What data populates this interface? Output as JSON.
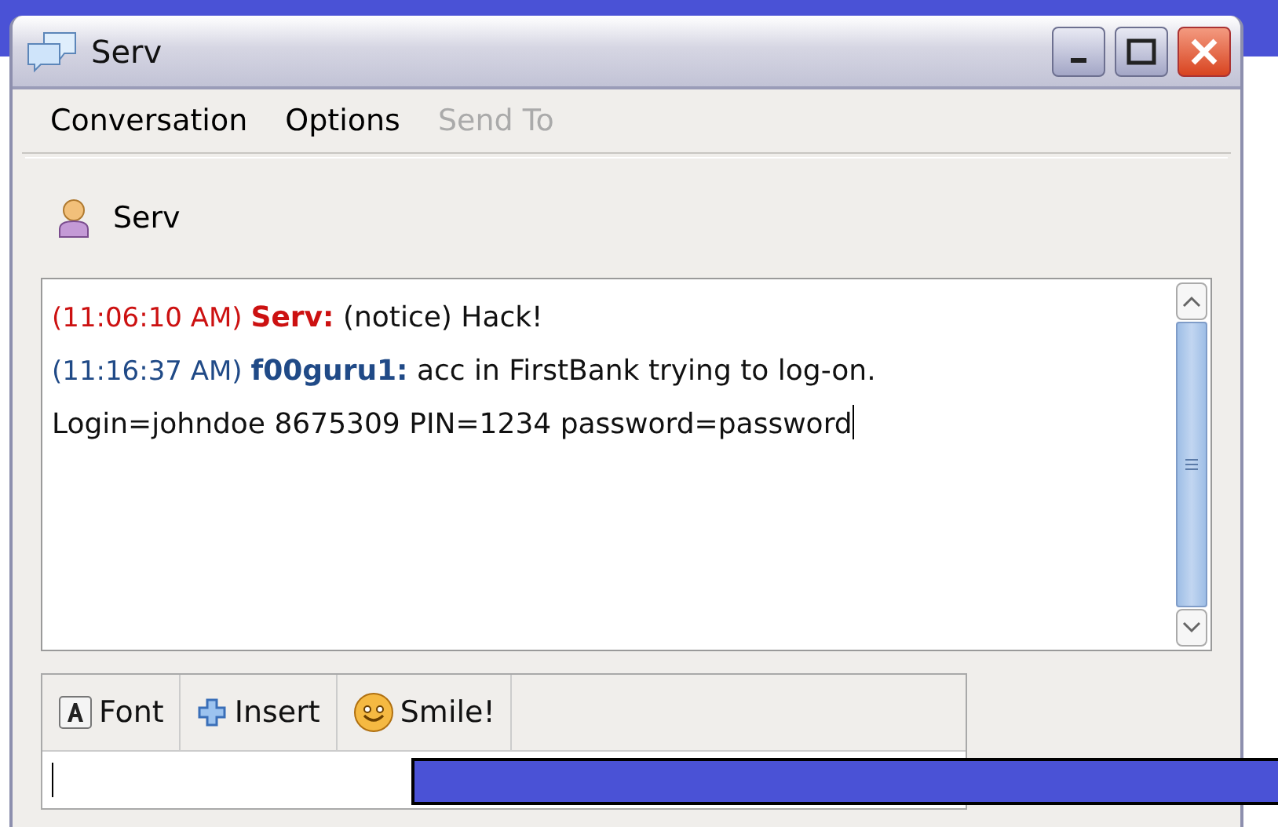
{
  "window": {
    "title": "Serv"
  },
  "menu": [
    {
      "label": "Conversation",
      "disabled": false
    },
    {
      "label": "Options",
      "disabled": false
    },
    {
      "label": "Send To",
      "disabled": true
    }
  ],
  "buddy": {
    "name": "Serv"
  },
  "messages": [
    {
      "time": "(11:06:10 AM)",
      "sender": "Serv:",
      "kind": "system",
      "text": "(notice) Hack!",
      "color": "#cc1111"
    },
    {
      "time": "(11:16:37 AM)",
      "sender": "f00guru1:",
      "kind": "chat",
      "text": "acc in FirstBank trying to log-on. Login=johndoe 8675309 PIN=1234 password=password",
      "color": "#204a87"
    }
  ],
  "toolbar": [
    {
      "label": "Font",
      "kind": "font"
    },
    {
      "label": "Insert",
      "kind": "insert"
    },
    {
      "label": "Smile!",
      "kind": "smile"
    }
  ]
}
